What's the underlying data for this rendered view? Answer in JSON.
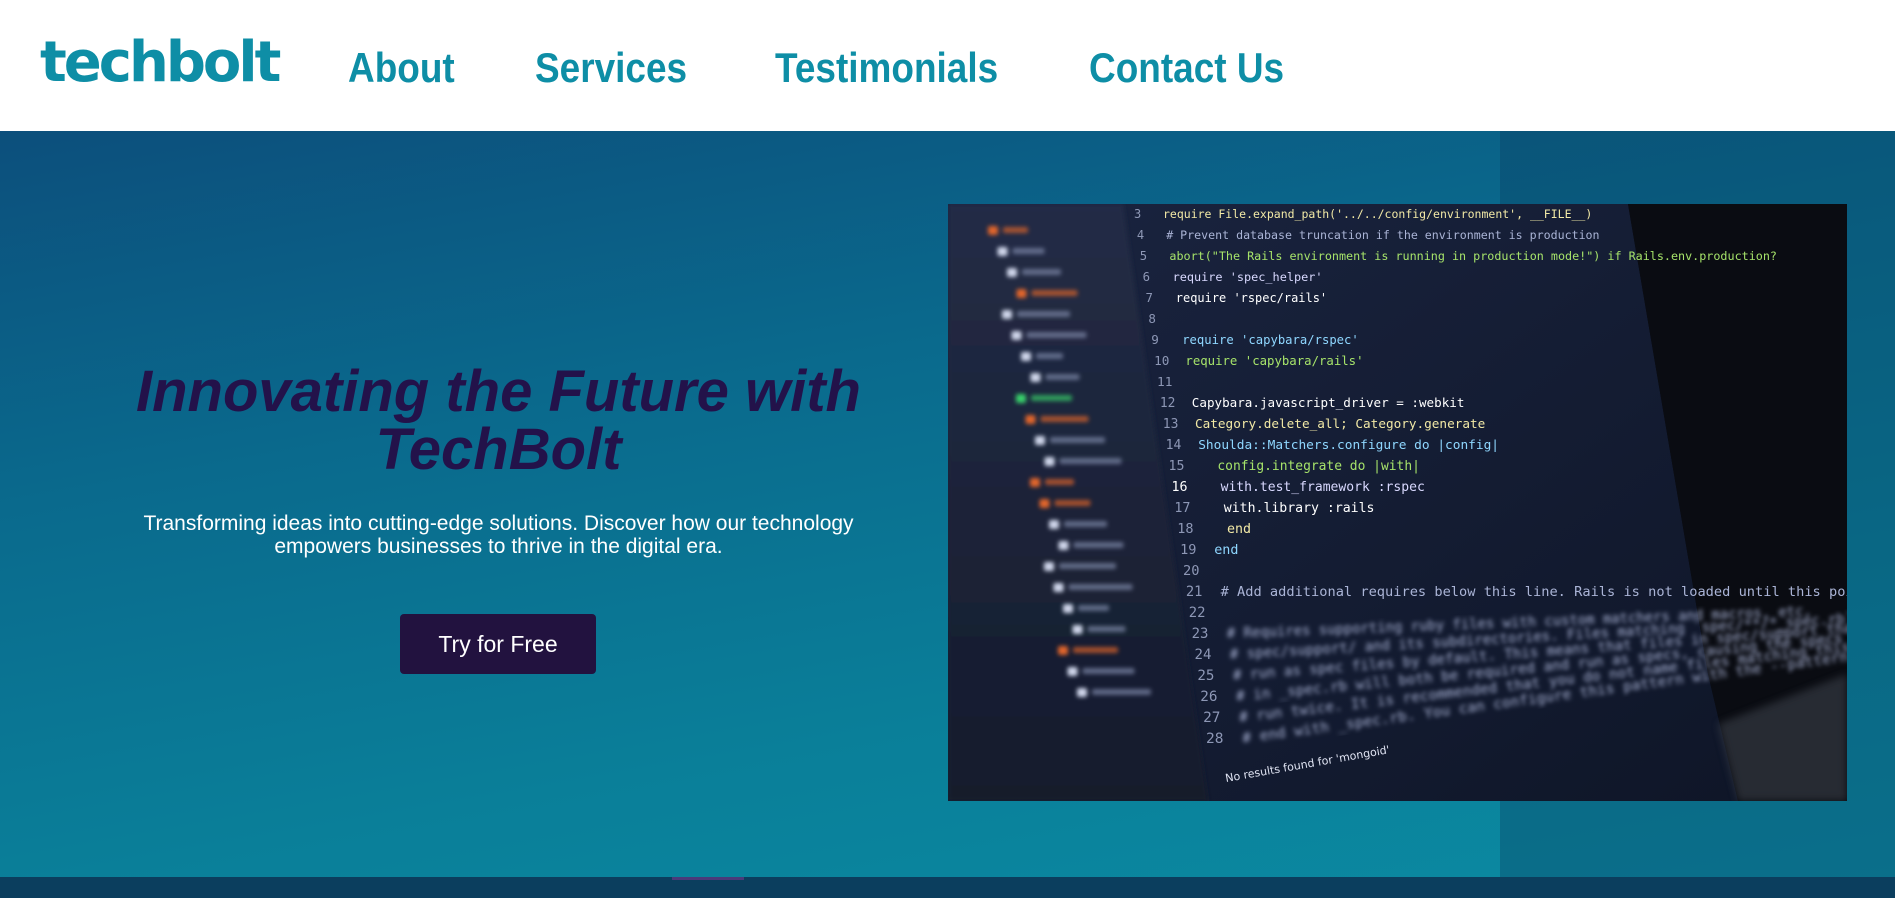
{
  "brand": {
    "logo_text": "techbolt",
    "primary_color": "#0e8ea6",
    "dark_color": "#22123f"
  },
  "nav": {
    "items": [
      {
        "label": "About"
      },
      {
        "label": "Services"
      },
      {
        "label": "Testimonials"
      },
      {
        "label": "Contact Us"
      }
    ]
  },
  "hero": {
    "title": "Innovating the Future with TechBolt",
    "subtitle": "Transforming ideas into cutting-edge solutions. Discover how our technology empowers businesses to thrive in the digital era.",
    "cta_label": "Try for Free"
  },
  "image": {
    "description_icon": "laptop-code-photo",
    "code_lines": [
      {
        "n": "3",
        "t": "require File.expand_path('../../config/environment', __FILE__)"
      },
      {
        "n": "4",
        "t": "# Prevent database truncation if the environment is production"
      },
      {
        "n": "5",
        "t": "abort(\"The Rails environment is running in production mode!\") if Rails.env.production?"
      },
      {
        "n": "6",
        "t": "require 'spec_helper'"
      },
      {
        "n": "7",
        "t": "require 'rspec/rails'"
      },
      {
        "n": "8",
        "t": ""
      },
      {
        "n": "9",
        "t": "require 'capybara/rspec'"
      },
      {
        "n": "10",
        "t": "require 'capybara/rails'"
      },
      {
        "n": "11",
        "t": ""
      },
      {
        "n": "12",
        "t": "Capybara.javascript_driver = :webkit"
      },
      {
        "n": "13",
        "t": "Category.delete_all; Category.generate"
      },
      {
        "n": "14",
        "t": "Shoulda::Matchers.configure do |config|"
      },
      {
        "n": "15",
        "t": "  config.integrate do |with|"
      },
      {
        "n": "16",
        "t": "    with.test_framework :rspec"
      },
      {
        "n": "17",
        "t": "    with.library :rails"
      },
      {
        "n": "18",
        "t": "  end"
      },
      {
        "n": "19",
        "t": "end"
      },
      {
        "n": "20",
        "t": ""
      },
      {
        "n": "21",
        "t": "# Add additional requires below this line. Rails is not loaded until this point!"
      },
      {
        "n": "22",
        "t": ""
      },
      {
        "n": "23",
        "t": "# Requires supporting ruby files with custom matchers and macros, etc,"
      },
      {
        "n": "24",
        "t": "# spec/support/ and its subdirectories. Files matching `spec/**/*_spec.rb` are"
      },
      {
        "n": "25",
        "t": "# run as spec files by default. This means that files in spec/support that end"
      },
      {
        "n": "26",
        "t": "# in _spec.rb will both be required and run as specs, causing the specs to be"
      },
      {
        "n": "27",
        "t": "# run twice. It is recommended that you do not name files matching this glob to"
      },
      {
        "n": "28",
        "t": "# end with _spec.rb. You can configure this pattern with the --pattern"
      }
    ],
    "status_text": "No results found for 'mongoid'"
  }
}
